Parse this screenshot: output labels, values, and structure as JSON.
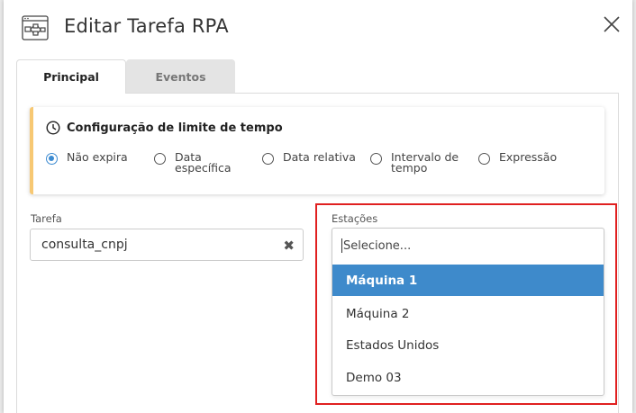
{
  "dialog": {
    "title": "Editar Tarefa RPA",
    "icon": "workflow-icon",
    "close_icon": "close-icon"
  },
  "tabs": [
    {
      "label": "Principal",
      "active": true
    },
    {
      "label": "Eventos",
      "active": false
    }
  ],
  "time_limit": {
    "title": "Configuração de limite de tempo",
    "accent_color": "#f7c873",
    "options": [
      {
        "label": "Não expira",
        "checked": true
      },
      {
        "label": "Data específica",
        "checked": false
      },
      {
        "label": "Data relativa",
        "checked": false
      },
      {
        "label": "Intervalo de tempo",
        "checked": false
      },
      {
        "label": "Expressão",
        "checked": false
      }
    ]
  },
  "tarefa": {
    "label": "Tarefa",
    "value": "consulta_cnpj"
  },
  "estacoes": {
    "label": "Estações",
    "placeholder": "Selecione...",
    "options": [
      "Máquina 1",
      "Máquina 2",
      "Estados Unidos",
      "Demo 03"
    ],
    "highlighted_option": "Máquina 1",
    "highlight_color": "#3e8acb"
  },
  "annotation_color": "#e02020"
}
